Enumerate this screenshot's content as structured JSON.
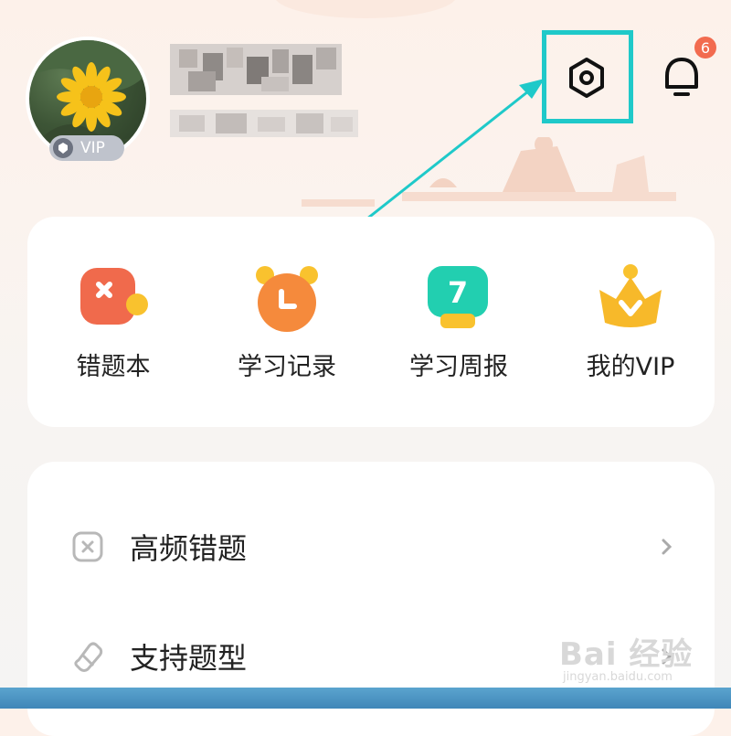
{
  "profile": {
    "vip_badge": "VIP",
    "name_blurred": true
  },
  "header": {
    "settings_icon": "settings-hexagon-icon",
    "bell_icon": "bell-icon",
    "notification_count": "6"
  },
  "quick_actions": [
    {
      "label": "错题本",
      "icon": "wrong-book-icon"
    },
    {
      "label": "学习记录",
      "icon": "alarm-clock-icon"
    },
    {
      "label": "学习周报",
      "icon": "calendar-7-icon"
    },
    {
      "label": "我的VIP",
      "icon": "crown-icon"
    }
  ],
  "menu": [
    {
      "label": "高频错题",
      "icon": "x-square-icon"
    },
    {
      "label": "支持题型",
      "icon": "eraser-icon"
    }
  ],
  "watermark": {
    "main": "Bai 经验",
    "sub": "jingyan.baidu.com"
  },
  "colors": {
    "highlight": "#1fc9c9",
    "badge": "#f26b4f",
    "background": "#fdf1ea"
  }
}
